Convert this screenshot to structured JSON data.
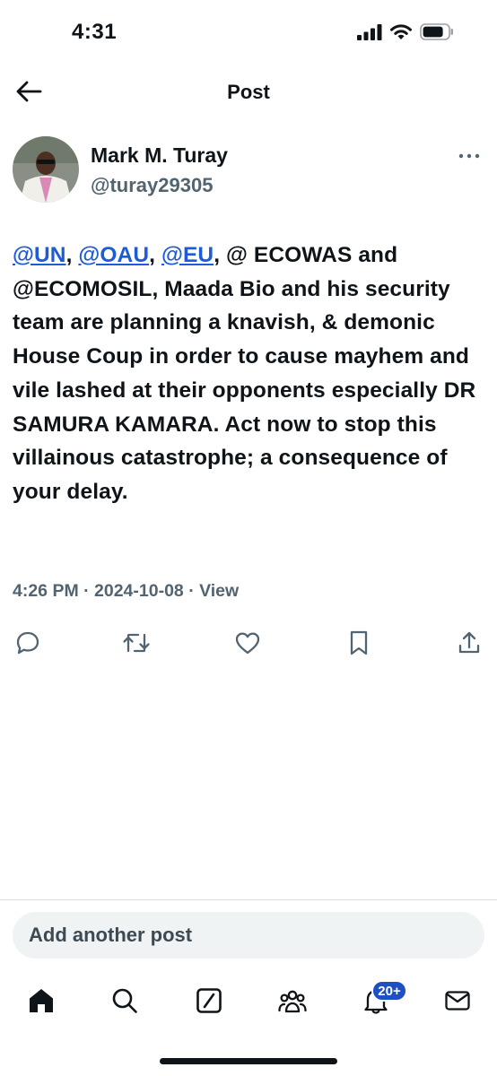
{
  "status_bar": {
    "time": "4:31"
  },
  "header": {
    "title": "Post"
  },
  "author": {
    "name": "Mark M. Turay",
    "handle": "@turay29305"
  },
  "post": {
    "segments": [
      {
        "text": "@UN",
        "type": "mention"
      },
      {
        "text": ", ",
        "type": "text"
      },
      {
        "text": "@OAU",
        "type": "mention"
      },
      {
        "text": ", ",
        "type": "text"
      },
      {
        "text": "@EU",
        "type": "mention"
      },
      {
        "text": ", @ ECOWAS and @ECOMOSIL, Maada Bio and his security team are planning a knavish, & demonic House Coup in order to cause mayhem and vile lashed at their opponents especially DR SAMURA KAMARA. Act now to stop this villainous catastrophe; a consequence of your delay.",
        "type": "text"
      }
    ],
    "timestamp": "4:26 PM · 2024-10-08 · View"
  },
  "actions": {
    "icons": [
      "reply-icon",
      "repost-icon",
      "like-icon",
      "bookmark-icon",
      "share-icon"
    ]
  },
  "compose": {
    "placeholder": "Add another post"
  },
  "tabbar": {
    "icons": [
      "home-icon",
      "search-icon",
      "grok-icon",
      "communities-icon",
      "notifications-icon",
      "messages-icon"
    ],
    "notifications_badge": "20+"
  },
  "colors": {
    "mention": "#1d5bd7",
    "badge": "#1d4fc5",
    "secondary_text": "#536471"
  }
}
